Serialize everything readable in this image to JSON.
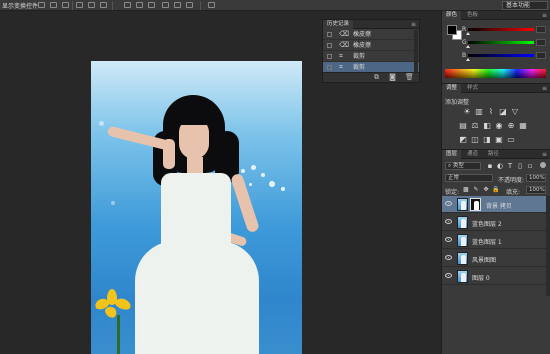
{
  "options_bar": {
    "show_transform_controls": "显示变换控件",
    "workspace": "基本功能"
  },
  "history_panel": {
    "tabs": [
      "历史记录",
      ""
    ],
    "items": [
      {
        "label": "橡皮擦",
        "icon": "eraser-icon",
        "active": false
      },
      {
        "label": "橡皮擦",
        "icon": "eraser-icon",
        "active": false
      },
      {
        "label": "裁剪",
        "icon": "crop-icon",
        "active": false
      },
      {
        "label": "裁剪",
        "icon": "crop-icon",
        "active": true
      }
    ]
  },
  "color_panel": {
    "tabs": [
      "颜色",
      "色板"
    ],
    "channels": [
      "R",
      "G",
      "B"
    ],
    "foreground": "#000000",
    "background": "#ffffff"
  },
  "adjustments_panel": {
    "tabs": [
      "调整",
      "样式"
    ],
    "add_adjustment": "添加调整"
  },
  "layers_panel": {
    "tabs": [
      "图层",
      "通道",
      "路径"
    ],
    "filter_kind": "类型",
    "blend_mode": "正常",
    "opacity_label": "不透明度:",
    "opacity_value": "100%",
    "lock_label": "锁定:",
    "fill_label": "填充:",
    "fill_value": "100%",
    "layers": [
      {
        "name": "背景 拷贝",
        "active": true,
        "has_mask": true
      },
      {
        "name": "蓝色图层 2",
        "active": false,
        "has_mask": false
      },
      {
        "name": "蓝色图层 1",
        "active": false,
        "has_mask": false
      },
      {
        "name": "风景图图",
        "active": false,
        "has_mask": false
      },
      {
        "name": "图层 0",
        "active": false,
        "has_mask": false
      }
    ]
  }
}
